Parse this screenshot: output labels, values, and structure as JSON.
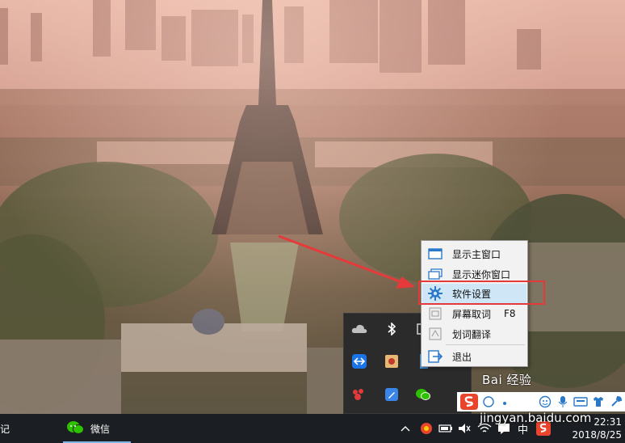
{
  "taskbar": {
    "left_partial_label": "记",
    "wechat_label": "微信",
    "ime_language": "中",
    "clock_time": "22:31",
    "clock_date": "2018/8/25"
  },
  "context_menu": {
    "items": [
      {
        "icon": "window-icon",
        "label": "显示主窗口",
        "shortcut": ""
      },
      {
        "icon": "mini-window-icon",
        "label": "显示迷你窗口",
        "shortcut": ""
      },
      {
        "icon": "gear-icon",
        "label": "软件设置",
        "shortcut": ""
      },
      {
        "icon": "screen-capture-icon",
        "label": "屏幕取词",
        "shortcut": "F8"
      },
      {
        "icon": "text-select-icon",
        "label": "划词翻译",
        "shortcut": ""
      },
      {
        "icon": "exit-icon",
        "label": "退出",
        "shortcut": ""
      }
    ],
    "highlighted_index": 2
  },
  "tray_panel": {
    "icons": [
      "onedrive-icon",
      "bluetooth-icon",
      "app-icon",
      "teamviewer-icon",
      "youdao-icon",
      "notepad-icon",
      "baidu-netdisk-icon",
      "wechat-icon"
    ]
  },
  "watermark": {
    "text": "Bai 经验",
    "url": "jingyan.baidu.com"
  },
  "colors": {
    "menu_highlight": "#cfe6f7",
    "annotation_red": "#e63a3a",
    "taskbar": "#1b1e22",
    "sogou_red": "#e8452c"
  }
}
